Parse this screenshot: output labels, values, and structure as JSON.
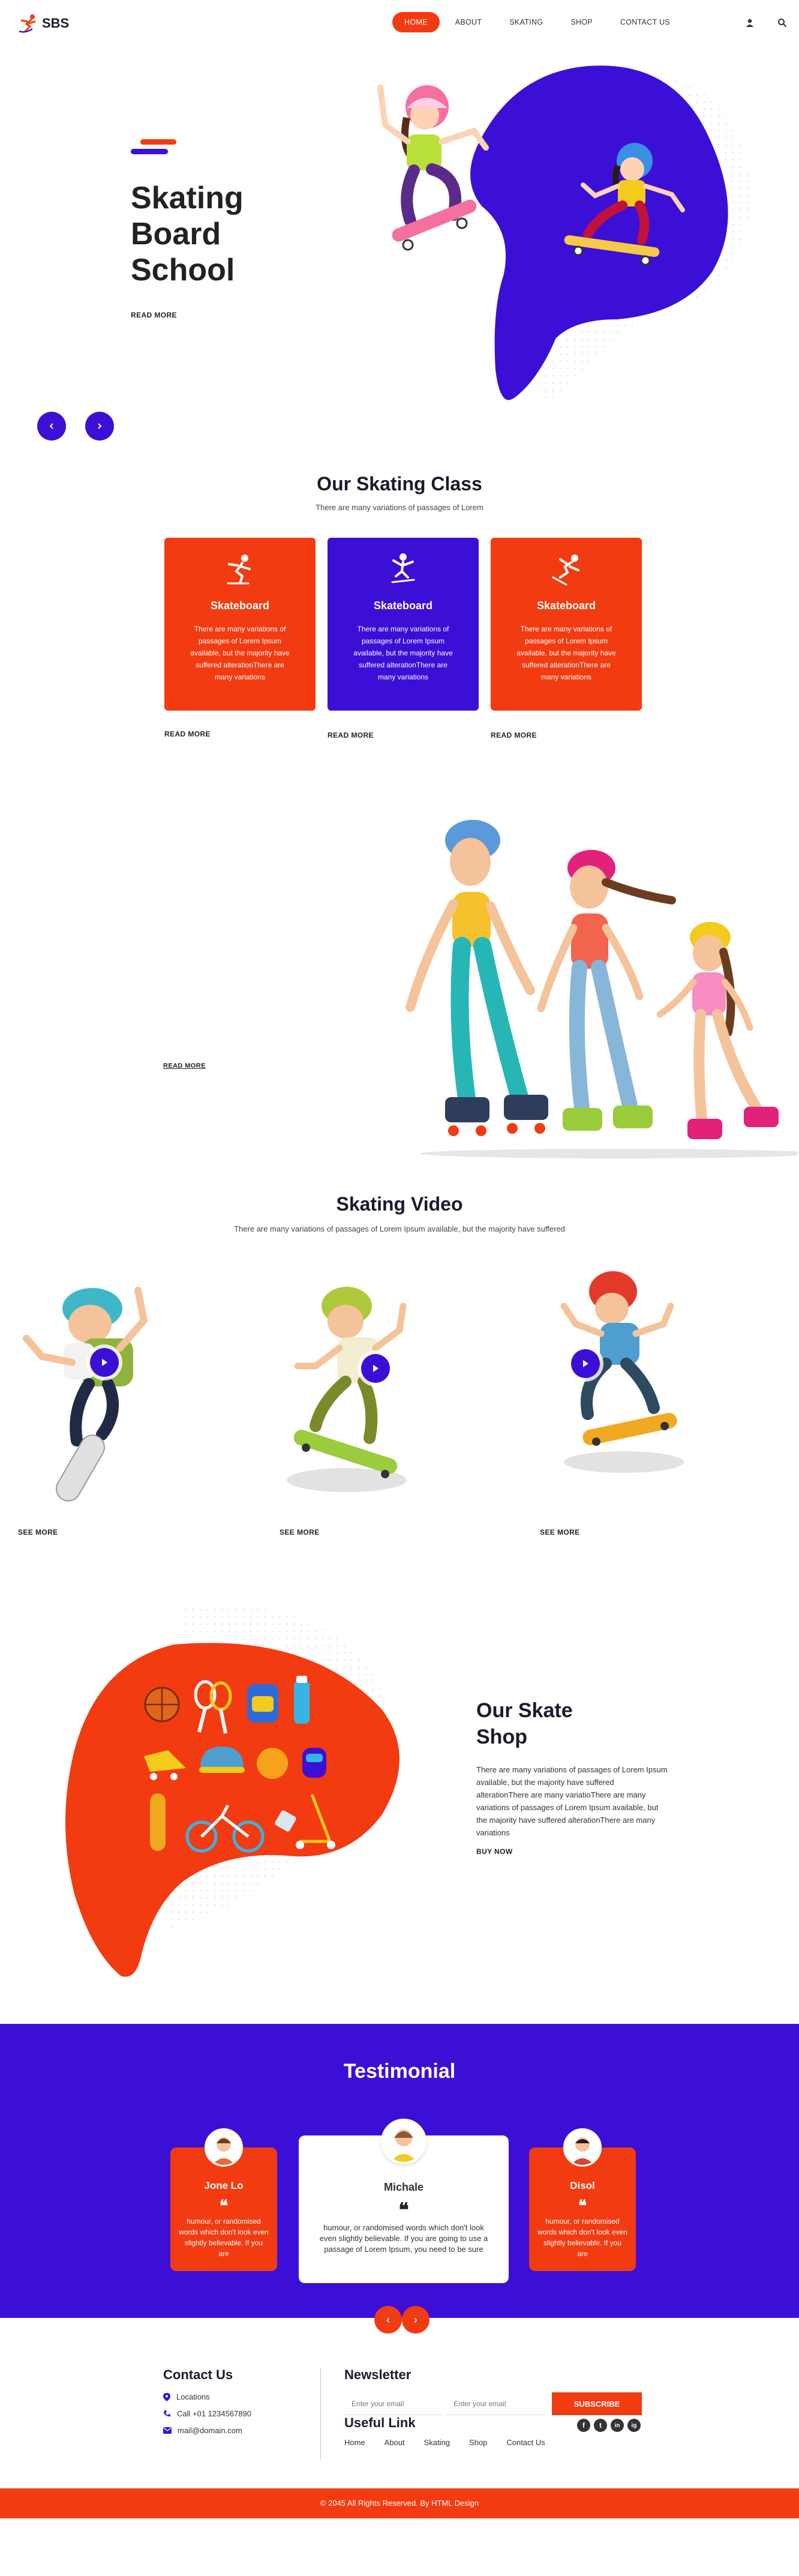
{
  "brand": {
    "name": "SBS",
    "accent": "#f23b11",
    "primary": "#3c0fd6"
  },
  "nav": {
    "items": [
      "HOME",
      "ABOUT",
      "SKATING",
      "SHOP",
      "CONTACT US"
    ],
    "active": 0
  },
  "header_icons": [
    "user-icon",
    "search-icon"
  ],
  "hero": {
    "title_lines": [
      "Skating",
      "Board",
      "School"
    ],
    "read_more": "READ MORE"
  },
  "classes": {
    "title": "Our Skating Class",
    "subtitle": "There are many variations of passages of Lorem",
    "cards": [
      {
        "title": "Skateboard",
        "text": "There are many variations of passages of Lorem Ipsum available, but the majority have suffered alterationThere are many variations",
        "read_more": "READ MORE",
        "color": "#f23b11"
      },
      {
        "title": "Skateboard",
        "text": "There are many variations of passages of Lorem Ipsum available, but the majority have suffered alterationThere are many variations",
        "read_more": "READ MORE",
        "color": "#3c0fd6"
      },
      {
        "title": "Skateboard",
        "text": "There are many variations of passages of Lorem Ipsum available, but the majority have suffered alterationThere are many variations",
        "read_more": "READ MORE",
        "color": "#f23b11"
      }
    ]
  },
  "family": {
    "read_more": "READ MORE"
  },
  "video": {
    "title": "Skating Video",
    "subtitle": "There are many variations of passages of Lorem Ipsum available, but the majority have suffered",
    "items": [
      {
        "see_more": "SEE MORE"
      },
      {
        "see_more": "SEE MORE"
      },
      {
        "see_more": "SEE MORE"
      }
    ]
  },
  "shop": {
    "title_lines": [
      "Our Skate",
      "Shop"
    ],
    "text": "There are many variations of passages of Lorem Ipsum available, but the majority have suffered alterationThere are many variatioThere are many variations of passages of Lorem Ipsum available, but the majority have suffered alterationThere are many variations",
    "buy_now": "BUY NOW"
  },
  "testimonial": {
    "title": "Testimonial",
    "cards": [
      {
        "name": "Jone Lo",
        "quote_mark": "❝",
        "text": "humour, or randomised words which don't look even slightly believable. If you are"
      },
      {
        "name": "Michale",
        "quote_mark": "❝",
        "text": "humour, or randomised words which don't look even slightly believable. If you are going to use a passage of Lorem Ipsum, you need to be sure"
      },
      {
        "name": "Disol",
        "quote_mark": "❝",
        "text": "humour, or randomised words which don't look even slightly believable. If you are"
      }
    ],
    "prev": "‹",
    "next": "›"
  },
  "footer": {
    "contact": {
      "title": "Contact Us",
      "location": "Locations",
      "phone": "Call +01 1234567890",
      "email": "mail@domain.com"
    },
    "newsletter": {
      "title": "Newsletter",
      "placeholder1": "Enter your email",
      "placeholder2": "Enter your email",
      "subscribe": "SUBSCRIBE"
    },
    "social": [
      "f",
      "t",
      "in",
      "ig"
    ],
    "useful": {
      "title": "Useful Link",
      "links": [
        "Home",
        "About",
        "Skating",
        "Shop",
        "Contact Us"
      ]
    },
    "copyright": "© 2045 All Rights Reserved. By HTML Design"
  }
}
